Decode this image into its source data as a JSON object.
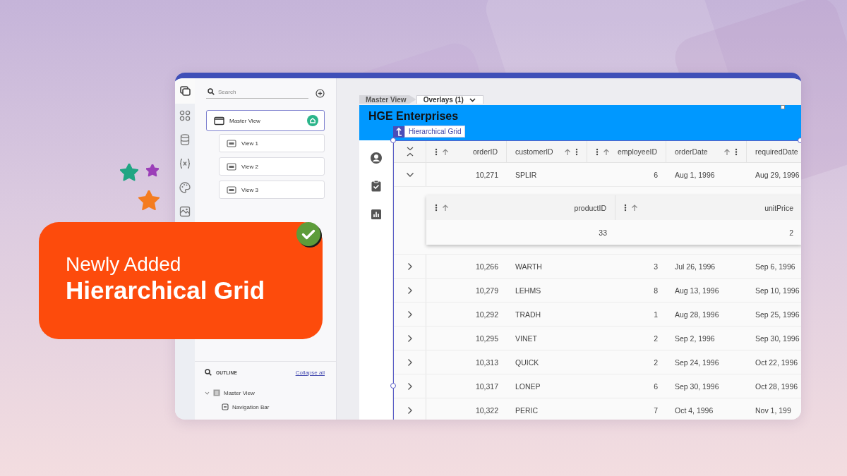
{
  "banner": {
    "eyebrow": "Newly Added",
    "title": "Hierarchical Grid",
    "done": true
  },
  "window": {
    "rail": [
      {
        "selected": true
      },
      {
        "selected": false
      },
      {
        "selected": false
      },
      {
        "selected": false
      },
      {
        "selected": false
      },
      {
        "selected": false
      }
    ],
    "search": {
      "placeholder": "Search"
    },
    "views": [
      {
        "label": "Master View",
        "selected": true,
        "start": true,
        "children": [
          {
            "label": "View 1",
            "selected": false
          },
          {
            "label": "View 2",
            "selected": false
          },
          {
            "label": "View 3",
            "selected": false
          }
        ]
      }
    ],
    "outline": {
      "title": "OUTLINE",
      "action": "Collapse all",
      "tree": [
        {
          "label": "Master View",
          "expanded": true,
          "children": [
            {
              "label": "Navigation Bar"
            }
          ]
        }
      ]
    },
    "breadcrumb": [
      {
        "label": "Master View",
        "selected": false
      },
      {
        "label": "Overlays (1)",
        "selected": true
      }
    ],
    "app": {
      "title": "HGE Enterprises",
      "selection_label": "Hierarchical Grid",
      "grid": {
        "columns": [
          {
            "label": "orderID",
            "kind": "number",
            "menu": true
          },
          {
            "label": "customerID",
            "kind": "text",
            "menu": true
          },
          {
            "label": "employeeID",
            "kind": "number",
            "menu": true
          },
          {
            "label": "orderDate",
            "kind": "text",
            "menu": true
          },
          {
            "label": "requiredDate",
            "kind": "text"
          }
        ],
        "rows": [
          {
            "expanded": true,
            "cells": [
              "10,271",
              "SPLIR",
              "6",
              "Aug 1, 1996",
              "Aug 29, 1996"
            ],
            "child": {
              "columns": [
                {
                  "label": "productID",
                  "kind": "number",
                  "menu": true
                },
                {
                  "label": "unitPrice",
                  "kind": "number",
                  "menu": true
                }
              ],
              "rows": [
                [
                  "33",
                  "2"
                ]
              ]
            }
          },
          {
            "expanded": false,
            "cells": [
              "10,266",
              "WARTH",
              "3",
              "Jul 26, 1996",
              "Sep 6, 1996"
            ]
          },
          {
            "expanded": false,
            "cells": [
              "10,279",
              "LEHMS",
              "8",
              "Aug 13, 1996",
              "Sep 10, 1996"
            ]
          },
          {
            "expanded": false,
            "cells": [
              "10,292",
              "TRADH",
              "1",
              "Aug 28, 1996",
              "Sep 25, 1996"
            ]
          },
          {
            "expanded": false,
            "cells": [
              "10,295",
              "VINET",
              "2",
              "Sep 2, 1996",
              "Sep 30, 1996"
            ]
          },
          {
            "expanded": false,
            "cells": [
              "10,313",
              "QUICK",
              "2",
              "Sep 24, 1996",
              "Oct 22, 1996"
            ]
          },
          {
            "expanded": false,
            "cells": [
              "10,317",
              "LONEP",
              "6",
              "Sep 30, 1996",
              "Oct 28, 1996"
            ]
          },
          {
            "expanded": false,
            "cells": [
              "10,322",
              "PERIC",
              "7",
              "Oct 4, 1996",
              "Nov 1, 199"
            ]
          }
        ]
      }
    }
  }
}
